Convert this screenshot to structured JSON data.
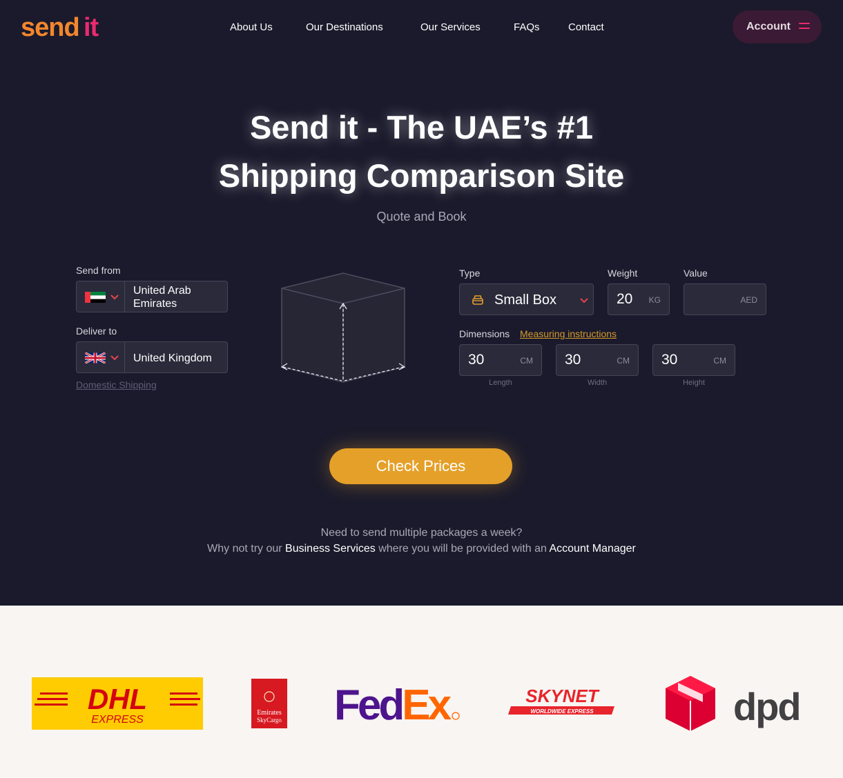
{
  "header": {
    "logo_send": "send",
    "logo_it": "it",
    "nav": [
      "About Us",
      "Our Destinations",
      "Our Services",
      "FAQs",
      "Contact"
    ],
    "account_label": "Account"
  },
  "hero": {
    "title_line1": "Send it - The UAE’s #1",
    "title_line2": "Shipping Comparison Site",
    "subtitle": "Quote and Book"
  },
  "form": {
    "send_from_label": "Send from",
    "send_from_value_line1": "United Arab",
    "send_from_value_line2": "Emirates",
    "deliver_to_label": "Deliver to",
    "deliver_to_value": "United Kingdom",
    "domestic_link": "Domestic Shipping",
    "type_label": "Type",
    "type_value": "Small Box",
    "weight_label": "Weight",
    "weight_value": "20",
    "weight_unit": "KG",
    "value_label": "Value",
    "value_value": "",
    "value_unit": "AED",
    "dimensions_label": "Dimensions",
    "measuring_link": "Measuring instructions",
    "length_value": "30",
    "width_value": "30",
    "height_value": "30",
    "dim_unit": "CM",
    "length_label": "Length",
    "width_label": "Width",
    "height_label": "Height",
    "check_button": "Check Prices"
  },
  "note": {
    "line1": "Need to send multiple packages a week?",
    "line2_a": "Why not try our ",
    "line2_b": "Business Services",
    "line2_c": " where you will be provided with an ",
    "line2_d": "Account Manager"
  },
  "partners": {
    "dhl": "DHL",
    "dhl_sub": "EXPRESS",
    "emirates_line1": "Emirates",
    "emirates_line2": "SkyCargo",
    "fedex_a": "Fed",
    "fedex_b": "Ex",
    "skynet": "SKYNET",
    "skynet_sub": "WORLDWIDE EXPRESS",
    "dpd": "dpd"
  },
  "colors": {
    "background": "#1a1a2c",
    "accent_orange": "#f4862c",
    "accent_pink": "#ea2a6f",
    "button": "#e5a029",
    "link": "#d49a2b"
  }
}
